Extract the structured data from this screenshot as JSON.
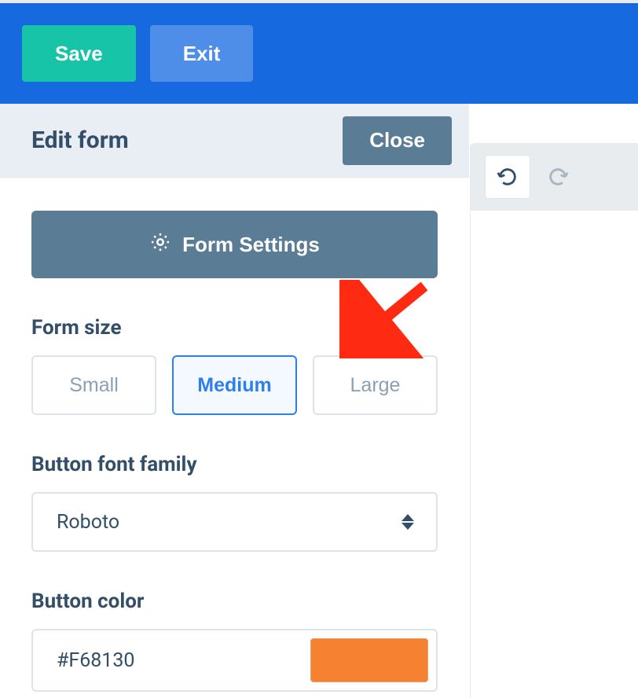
{
  "topbar": {
    "save_label": "Save",
    "exit_label": "Exit"
  },
  "panel": {
    "title": "Edit form",
    "close_label": "Close",
    "form_settings_label": "Form Settings"
  },
  "form_size": {
    "label": "Form size",
    "options": [
      "Small",
      "Medium",
      "Large"
    ],
    "selected": "Medium"
  },
  "font_family": {
    "label": "Button font family",
    "value": "Roboto"
  },
  "button_color": {
    "label": "Button color",
    "value": "#F68130",
    "swatch": "#F68130"
  },
  "preview": {
    "undo_icon": "undo",
    "redo_icon": "redo"
  }
}
